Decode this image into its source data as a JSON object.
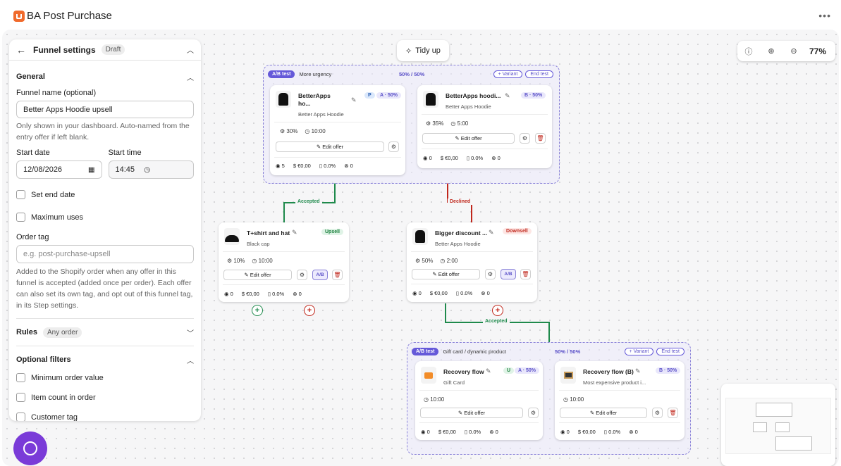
{
  "app": {
    "title": "BA Post Purchase"
  },
  "panel": {
    "title": "Funnel settings",
    "status": "Draft",
    "general_title": "General",
    "funnel_name_label": "Funnel name (optional)",
    "funnel_name_value": "Better Apps Hoodie upsell",
    "funnel_name_help": "Only shown in your dashboard. Auto-named from the entry offer if left blank.",
    "start_date_label": "Start date",
    "start_date_value": "12/08/2026",
    "start_time_label": "Start time",
    "start_time_value": "14:45",
    "set_end_date": "Set end date",
    "maximum_uses": "Maximum uses",
    "order_tag_label": "Order tag",
    "order_tag_placeholder": "e.g. post-purchase-upsell",
    "order_tag_help": "Added to the Shopify order when any offer in this funnel is accepted (added once per order). Each offer can also set its own tag, and opt out of this funnel tag, in its Step settings.",
    "rules_title": "Rules",
    "rules_badge": "Any order",
    "optional_filters_title": "Optional filters",
    "min_order_value": "Minimum order value",
    "item_count": "Item count in order",
    "customer_tag_cut": "Customer tag"
  },
  "toolbar": {
    "tidy_label": "Tidy up",
    "zoom_level": "77%"
  },
  "group1": {
    "ab": "A/B test",
    "name": "More urgency",
    "split": "50% / 50%",
    "add_variant": "+ Variant",
    "end_test": "End test"
  },
  "group2": {
    "ab": "A/B test",
    "name": "Gift card / dynamic product",
    "split": "50% / 50%",
    "add_variant": "+ Variant",
    "end_test": "End test"
  },
  "cards": {
    "a": {
      "title1": "BetterApps",
      "title2": "ho...",
      "sub": "Better Apps Hoodie",
      "badge": "P",
      "tag": "A · 50%",
      "discount": "30%",
      "timer": "10:00",
      "edit": "Edit offer",
      "views": "5",
      "revenue": "€0,00",
      "conv": "0.0%",
      "declines": "0"
    },
    "b": {
      "title": "BetterApps hoodi...",
      "sub": "Better Apps Hoodie",
      "tag": "B · 50%",
      "discount": "35%",
      "timer": "5:00",
      "edit": "Edit offer",
      "views": "0",
      "revenue": "€0,00",
      "conv": "0.0%",
      "declines": "0"
    },
    "upsell": {
      "title": "T+shirt and hat",
      "sub": "Black cap",
      "tag": "Upsell",
      "discount": "10%",
      "timer": "10:00",
      "edit": "Edit offer",
      "ab": "A/B",
      "views": "0",
      "revenue": "€0,00",
      "conv": "0.0%",
      "declines": "0"
    },
    "downsell": {
      "title": "Bigger discount ...",
      "sub": "Better Apps Hoodie",
      "tag": "Downsell",
      "discount": "50%",
      "timer": "2:00",
      "edit": "Edit offer",
      "ab": "A/B",
      "views": "0",
      "revenue": "€0,00",
      "conv": "0.0%",
      "declines": "0"
    },
    "rf1": {
      "title": "Recovery flow",
      "sub": "Gift Card",
      "badge": "U",
      "tag": "A · 50%",
      "timer": "10:00",
      "edit": "Edit offer",
      "views": "0",
      "revenue": "€0,00",
      "conv": "0.0%",
      "declines": "0"
    },
    "rf2": {
      "title": "Recovery flow (B)",
      "sub": "Most expensive product i...",
      "tag": "B · 50%",
      "timer": "10:00",
      "edit": "Edit offer",
      "views": "0",
      "revenue": "€0,00",
      "conv": "0.0%",
      "declines": "0"
    }
  },
  "edges": {
    "accepted": "Accepted",
    "declined": "Declined",
    "accepted2": "Accepted"
  },
  "colors": {
    "accent": "#6559d9",
    "accepted": "#1f8a4c",
    "declined": "#c0271c",
    "chat": "#7a3bd8",
    "logo": "#f06a2c"
  }
}
